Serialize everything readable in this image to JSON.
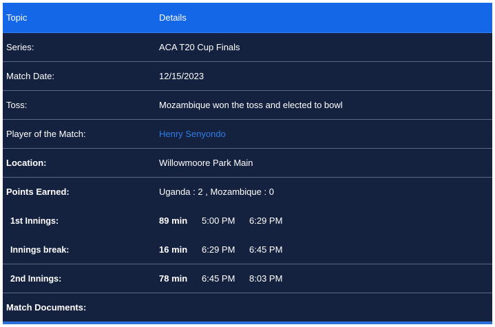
{
  "header": {
    "topic": "Topic",
    "details": "Details"
  },
  "rows": [
    {
      "label": "Series:",
      "value": "ACA T20 Cup Finals"
    },
    {
      "label": "Match Date:",
      "value": "12/15/2023"
    },
    {
      "label": "Toss:",
      "value": "Mozambique won the toss and elected to bowl"
    },
    {
      "label": "Player of the Match:",
      "value": "Henry Senyondo"
    },
    {
      "label": "Location:",
      "value": "Willowmoore Park Main"
    },
    {
      "label": "Points Earned:",
      "value": "Uganda : 2 , Mozambique : 0"
    }
  ],
  "innings": [
    {
      "label": "1st Innings:",
      "duration": "89 min",
      "start": "5:00 PM",
      "end": "6:29 PM"
    },
    {
      "label": "Innings break:",
      "duration": "16 min",
      "start": "6:29 PM",
      "end": "6:45 PM"
    },
    {
      "label": "2nd Innings:",
      "duration": "78 min",
      "start": "6:45 PM",
      "end": "8:03 PM"
    }
  ],
  "documents": {
    "label": "Match Documents:"
  },
  "colors": {
    "header": "#1467e6",
    "body": "#14213f",
    "link": "#2f7de8"
  }
}
